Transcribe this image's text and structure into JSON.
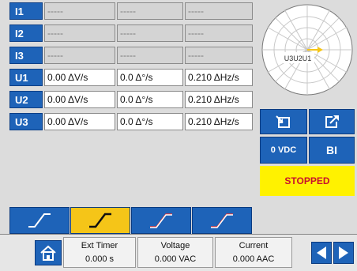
{
  "table": {
    "rows": [
      {
        "label": "I1",
        "c1": "-----",
        "c2": "-----",
        "c3": "-----",
        "filled": false
      },
      {
        "label": "I2",
        "c1": "-----",
        "c2": "-----",
        "c3": "-----",
        "filled": false
      },
      {
        "label": "I3",
        "c1": "-----",
        "c2": "-----",
        "c3": "-----",
        "filled": false
      },
      {
        "label": "U1",
        "c1": "0.00 ΔV/s",
        "c2": "0.0 Δ°/s",
        "c3": "0.210 ΔHz/s",
        "filled": true
      },
      {
        "label": "U2",
        "c1": "0.00 ΔV/s",
        "c2": "0.0 Δ°/s",
        "c3": "0.210 ΔHz/s",
        "filled": true
      },
      {
        "label": "U3",
        "c1": "0.00 ΔV/s",
        "c2": "0.0 Δ°/s",
        "c3": "0.210 ΔHz/s",
        "filled": true
      }
    ]
  },
  "vector_diagram": {
    "label": "U3U2U1"
  },
  "buttons": {
    "dc_label": "0 VDC",
    "bi_label": "BI",
    "status_label": "STOPPED"
  },
  "footer": {
    "ext_timer_label": "Ext Timer",
    "ext_timer_value": "0.000 s",
    "voltage_label": "Voltage",
    "voltage_value": "0.000 VAC",
    "current_label": "Current",
    "current_value": "0.000 AAC"
  },
  "icons": {
    "home": "home-icon",
    "import": "import-icon",
    "export": "export-icon",
    "left": "arrow-left-icon",
    "right": "arrow-right-icon"
  },
  "colors": {
    "accent_blue": "#1e63b8",
    "active_tab": "#f5c518",
    "status_bg": "#fff200",
    "status_text": "#c8102e",
    "vector_arrow": "#f5c518"
  }
}
